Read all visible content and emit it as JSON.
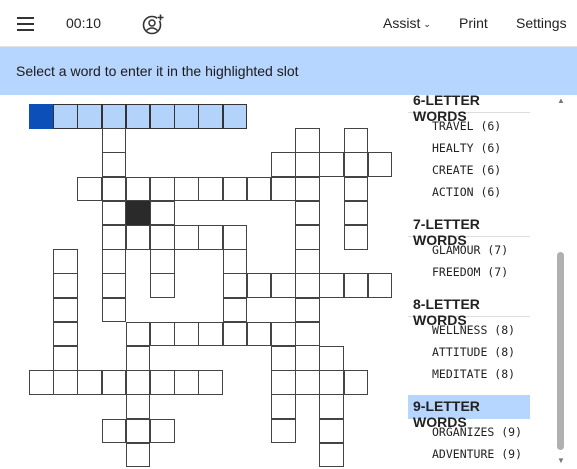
{
  "header": {
    "menu_icon": "hamburger-menu-icon",
    "timer": "00:10",
    "add_player_icon": "add-user-icon",
    "assist_label": "Assist",
    "assist_caret": "⌄",
    "print_label": "Print",
    "settings_label": "Settings"
  },
  "banner": {
    "text": "Select a word to enter it in the highlighted slot",
    "color": "#b7d6ff"
  },
  "word_list": {
    "groups": [
      {
        "title": "6-LETTER WORDS",
        "words": [
          "TRAVEL (6)",
          "HEALTY (6)",
          "CREATE (6)",
          "ACTION (6)"
        ]
      },
      {
        "title": "7-LETTER WORDS",
        "words": [
          "GLAMOUR (7)",
          "FREEDOM (7)"
        ]
      },
      {
        "title": "8-LETTER WORDS",
        "words": [
          "WELLNESS (8)",
          "ATTITUDE (8)",
          "MEDITATE (8)"
        ]
      },
      {
        "title": "9-LETTER WORDS",
        "words": [
          "ORGANIZES (9)",
          "ADVENTURE (9)"
        ],
        "selected": true
      }
    ]
  },
  "colors": {
    "highlight": "#b3d3fb",
    "active_cell": "#0d4fb8",
    "selected_group": "#b7d6ff"
  }
}
